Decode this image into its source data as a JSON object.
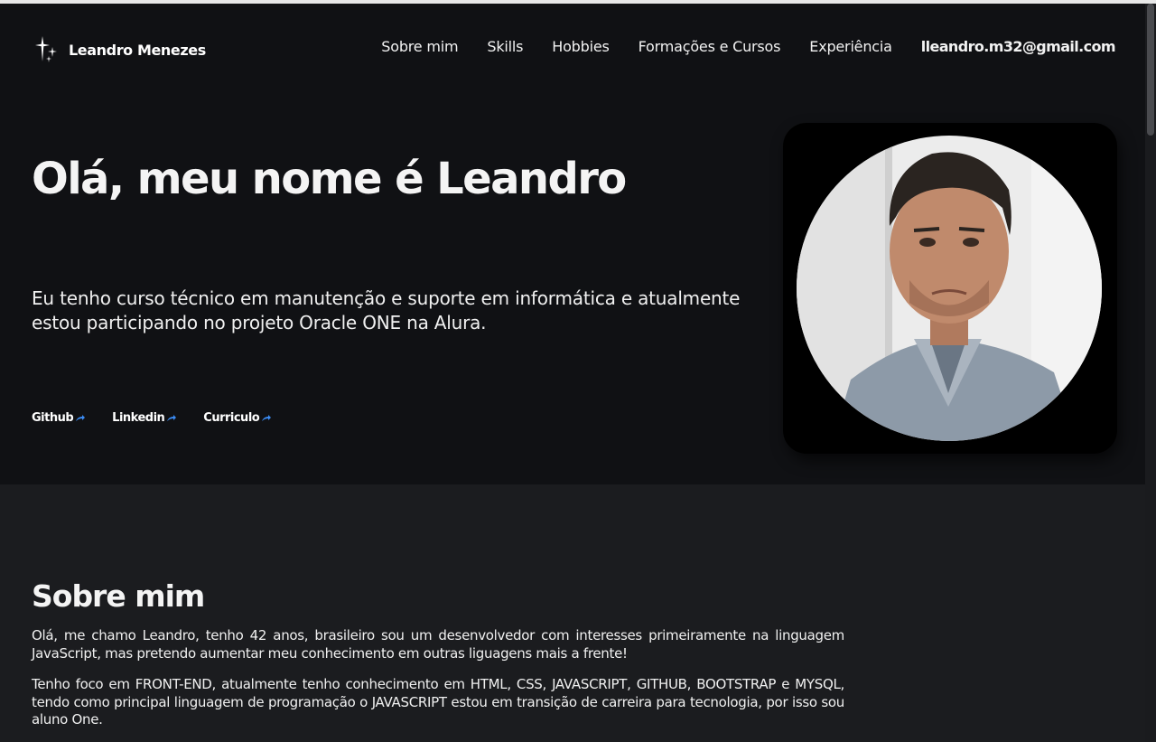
{
  "header": {
    "brand_name": "Leandro Menezes",
    "nav": [
      "Sobre mim",
      "Skills",
      "Hobbies",
      "Formações e Cursos",
      "Experiência"
    ],
    "email": "lleandro.m32@gmail.com"
  },
  "hero": {
    "title": "Olá, meu nome é Leandro",
    "description": "Eu tenho curso técnico em manutenção e suporte em informática e atualmente estou participando no projeto Oracle ONE na Alura.",
    "links": [
      "Github",
      "Linkedin",
      "Curriculo"
    ]
  },
  "about": {
    "title": "Sobre mim",
    "paragraphs": [
      "Olá, me chamo Leandro, tenho 42 anos, brasileiro sou um desenvolvedor com interesses primeiramente na linguagem JavaScript, mas pretendo aumentar meu conhecimento em outras liguagens mais a frente!",
      "Tenho foco em FRONT-END, atualmente tenho conhecimento em HTML, CSS, JAVASCRIPT, GITHUB, BOOTSTRAP e MYSQL, tendo como principal linguagem de programação o JAVASCRIPT estou em transição de carreira para tecnologia, por isso sou aluno One."
    ]
  },
  "colors": {
    "hero_bg": "#101114",
    "about_bg": "#1b1c1f",
    "link_arrow": "#3b8cf5"
  },
  "icons": {
    "brand": "sparkles-icon",
    "link_arrow": "arrow-up-right-icon"
  }
}
